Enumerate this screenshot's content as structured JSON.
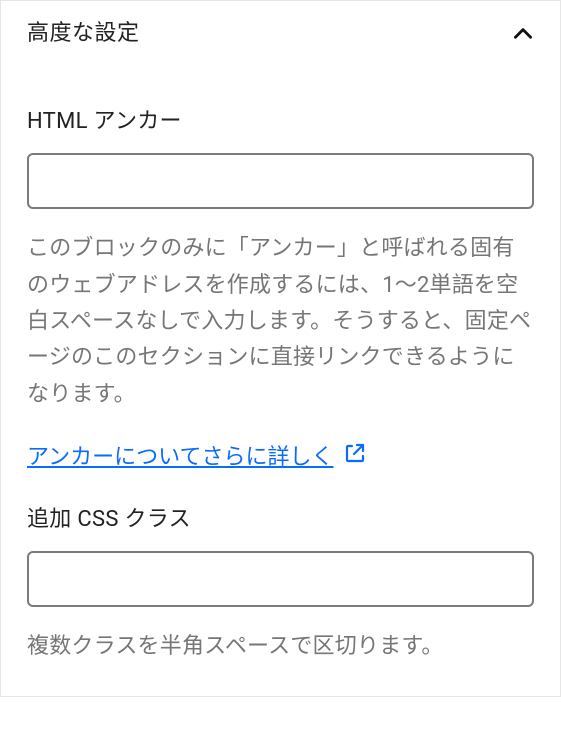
{
  "panel": {
    "title": "高度な設定",
    "fields": {
      "anchor": {
        "label": "HTML アンカー",
        "value": "",
        "help": "このブロックのみに「アンカー」と呼ばれる固有のウェブアドレスを作成するには、1〜2単語を空白スペースなしで入力します。そうすると、固定ページのこのセクションに直接リンクできるようになります。",
        "link_label": "アンカーについてさらに詳しく"
      },
      "css": {
        "label": "追加 CSS クラス",
        "value": "",
        "help": "複数クラスを半角スペースで区切ります。"
      }
    }
  }
}
